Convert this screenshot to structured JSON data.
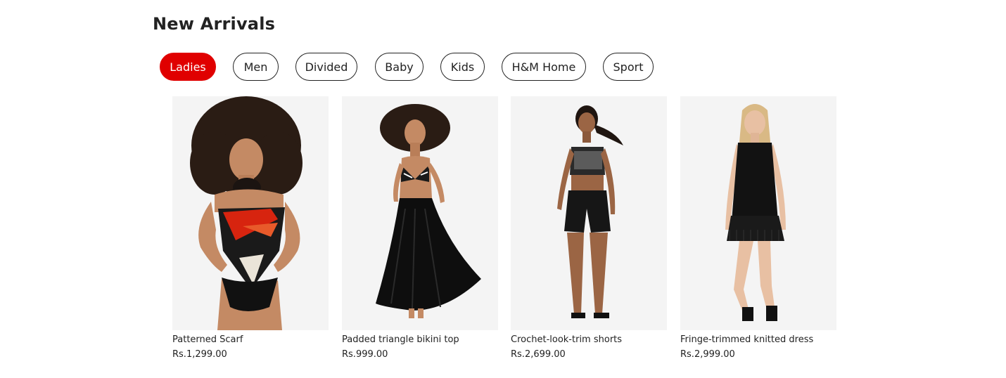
{
  "section": {
    "title": "New Arrivals"
  },
  "tabs": [
    {
      "label": "Ladies",
      "active": true
    },
    {
      "label": "Men",
      "active": false
    },
    {
      "label": "Divided",
      "active": false
    },
    {
      "label": "Baby",
      "active": false
    },
    {
      "label": "Kids",
      "active": false
    },
    {
      "label": "H&M Home",
      "active": false
    },
    {
      "label": "Sport",
      "active": false
    }
  ],
  "products": [
    {
      "name": "Patterned Scarf",
      "price": "Rs.1,299.00"
    },
    {
      "name": "Padded triangle bikini top",
      "price": "Rs.999.00"
    },
    {
      "name": "Crochet-look-trim shorts",
      "price": "Rs.2,699.00"
    },
    {
      "name": "Fringe-trimmed knitted dress",
      "price": "Rs.2,999.00"
    }
  ],
  "colors": {
    "accent": "#e00000",
    "text": "#222222",
    "photo_bg": "#f4f4f4"
  }
}
